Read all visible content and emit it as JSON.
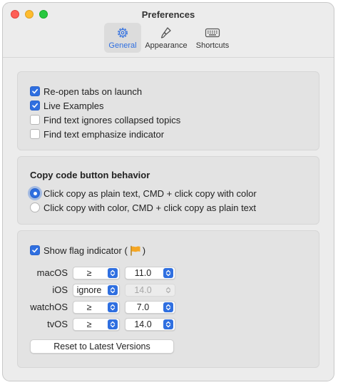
{
  "window": {
    "title": "Preferences"
  },
  "tabs": [
    {
      "label": "General",
      "icon": "gear-icon",
      "selected": true
    },
    {
      "label": "Appearance",
      "icon": "paintbrush-icon",
      "selected": false
    },
    {
      "label": "Shortcuts",
      "icon": "keyboard-icon",
      "selected": false
    }
  ],
  "general_options": [
    {
      "label": "Re-open tabs on launch",
      "checked": true
    },
    {
      "label": "Live Examples",
      "checked": true
    },
    {
      "label": "Find text ignores collapsed topics",
      "checked": false
    },
    {
      "label": "Find text emphasize indicator",
      "checked": false
    }
  ],
  "copy_behavior": {
    "heading": "Copy code button behavior",
    "options": [
      {
        "label": "Click copy as plain text, CMD + click copy with color",
        "selected": true
      },
      {
        "label": "Click copy with color, CMD + click copy as plain text",
        "selected": false
      }
    ]
  },
  "flag": {
    "label": "Show flag indicator (",
    "label_close": ")",
    "checked": true,
    "flag_icon": "flag-icon",
    "platforms": [
      {
        "name": "macOS",
        "operator": "≥",
        "version": "11.0",
        "version_enabled": true
      },
      {
        "name": "iOS",
        "operator": "ignore",
        "version": "14.0",
        "version_enabled": false
      },
      {
        "name": "watchOS",
        "operator": "≥",
        "version": "7.0",
        "version_enabled": true
      },
      {
        "name": "tvOS",
        "operator": "≥",
        "version": "14.0",
        "version_enabled": true
      }
    ],
    "reset_label": "Reset to Latest Versions"
  },
  "colors": {
    "accent": "#2f6fe0",
    "flag": "#f5a623"
  }
}
